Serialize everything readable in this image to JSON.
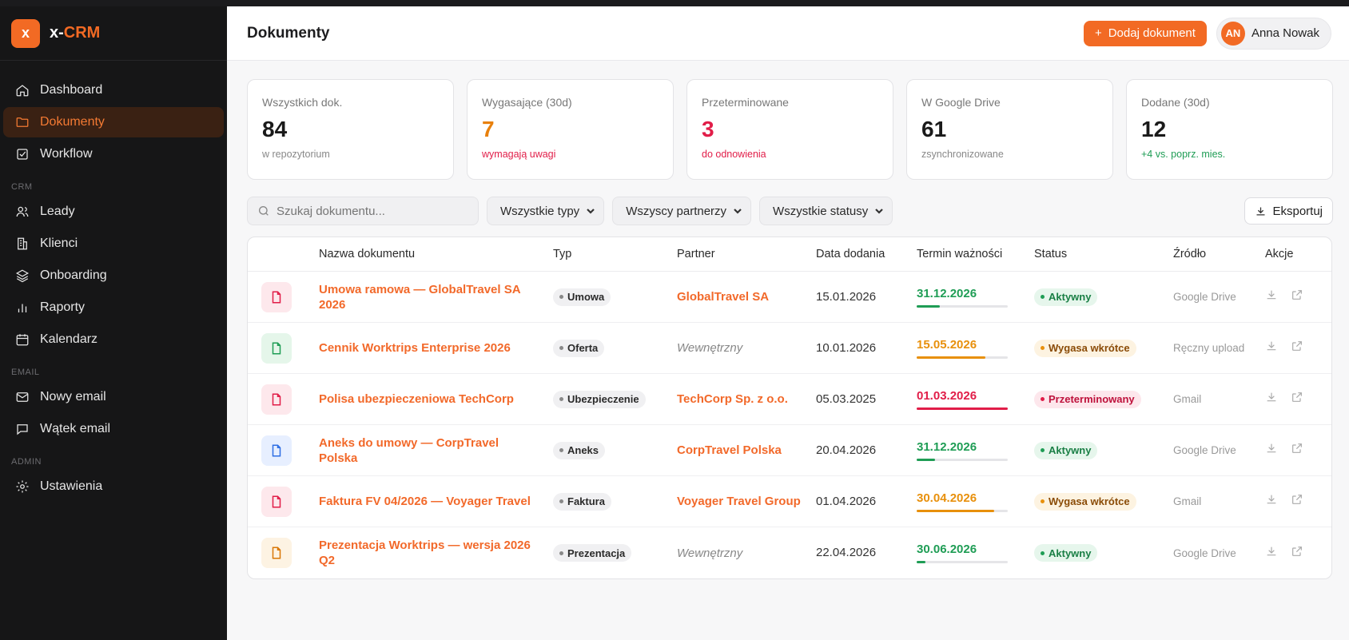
{
  "brand": {
    "logo_letter": "x",
    "name_prefix": "x-",
    "name_suffix": "CRM"
  },
  "colors": {
    "accent": "#f26a24",
    "sidebar_bg": "#161617",
    "active_bg": "#3a2113",
    "green": "#1f9d55",
    "orange": "#e8900c",
    "red": "#e11d48"
  },
  "sidebar": {
    "items": [
      {
        "label": "Dashboard",
        "icon": "home-icon",
        "active": false
      },
      {
        "label": "Dokumenty",
        "icon": "folder-icon",
        "active": true
      },
      {
        "label": "Workflow",
        "icon": "checkbox-icon",
        "active": false
      }
    ],
    "sections": [
      {
        "label": "CRM",
        "items": [
          {
            "label": "Leady",
            "icon": "users-icon"
          },
          {
            "label": "Klienci",
            "icon": "building-icon"
          },
          {
            "label": "Onboarding",
            "icon": "layers-icon"
          },
          {
            "label": "Raporty",
            "icon": "bar-chart-icon"
          },
          {
            "label": "Kalendarz",
            "icon": "calendar-icon"
          }
        ]
      },
      {
        "label": "EMAIL",
        "items": [
          {
            "label": "Nowy email",
            "icon": "mail-icon"
          },
          {
            "label": "Wątek email",
            "icon": "message-icon"
          }
        ]
      },
      {
        "label": "ADMIN",
        "items": [
          {
            "label": "Ustawienia",
            "icon": "gear-icon"
          }
        ]
      }
    ]
  },
  "header": {
    "title": "Dokumenty",
    "add_button": "Dodaj dokument",
    "user": {
      "initials": "AN",
      "name": "Anna Nowak"
    }
  },
  "stats": [
    {
      "label": "Wszystkich dok.",
      "value": "84",
      "sub": "w repozytorium",
      "value_color": "#1a1a1a",
      "sub_color": "#888888"
    },
    {
      "label": "Wygasające (30d)",
      "value": "7",
      "sub": "wymagają uwagi",
      "value_color": "#e8800c",
      "sub_color": "#e11d48"
    },
    {
      "label": "Przeterminowane",
      "value": "3",
      "sub": "do odnowienia",
      "value_color": "#e11d48",
      "sub_color": "#e11d48"
    },
    {
      "label": "W Google Drive",
      "value": "61",
      "sub": "zsynchronizowane",
      "value_color": "#1a1a1a",
      "sub_color": "#888888"
    },
    {
      "label": "Dodane (30d)",
      "value": "12",
      "sub": "+4 vs. poprz. mies.",
      "value_color": "#1a1a1a",
      "sub_color": "#1f9d55"
    }
  ],
  "filters": {
    "search_placeholder": "Szukaj dokumentu...",
    "type": "Wszystkie typy",
    "partner": "Wszyscy partnerzy",
    "status": "Wszystkie statusy",
    "export": "Eksportuj"
  },
  "table": {
    "columns": [
      "Nazwa dokumentu",
      "Typ",
      "Partner",
      "Data dodania",
      "Termin ważności",
      "Status",
      "Źródło",
      "Akcje"
    ],
    "rows": [
      {
        "name": "Umowa ramowa — GlobalTravel SA 2026",
        "type": "Umowa",
        "partner": "GlobalTravel SA",
        "partner_internal": false,
        "date": "15.01.2026",
        "expiry": "31.12.2026",
        "expiry_color": "#1f9d55",
        "progress": 0.25,
        "status": "Aktywny",
        "status_kind": "active",
        "source": "Google Drive",
        "icon_color": "#e11d48",
        "icon_bg": "#fde8ec"
      },
      {
        "name": "Cennik Worktrips Enterprise 2026",
        "type": "Oferta",
        "partner": "Wewnętrzny",
        "partner_internal": true,
        "date": "10.01.2026",
        "expiry": "15.05.2026",
        "expiry_color": "#e8900c",
        "progress": 0.75,
        "status": "Wygasa wkrótce",
        "status_kind": "warn",
        "source": "Ręczny upload",
        "icon_color": "#1f9d55",
        "icon_bg": "#e5f6ea"
      },
      {
        "name": "Polisa ubezpieczeniowa TechCorp",
        "type": "Ubezpieczenie",
        "partner": "TechCorp Sp. z o.o.",
        "partner_internal": false,
        "date": "05.03.2025",
        "expiry": "01.03.2026",
        "expiry_color": "#e11d48",
        "progress": 1.0,
        "status": "Przeterminowany",
        "status_kind": "expired",
        "source": "Gmail",
        "icon_color": "#e11d48",
        "icon_bg": "#fde8ec"
      },
      {
        "name": "Aneks do umowy — CorpTravel Polska",
        "type": "Aneks",
        "partner": "CorpTravel Polska",
        "partner_internal": false,
        "date": "20.04.2026",
        "expiry": "31.12.2026",
        "expiry_color": "#1f9d55",
        "progress": 0.2,
        "status": "Aktywny",
        "status_kind": "active",
        "source": "Google Drive",
        "icon_color": "#2f6fe4",
        "icon_bg": "#e7efff"
      },
      {
        "name": "Faktura FV 04/2026 — Voyager Travel",
        "type": "Faktura",
        "partner": "Voyager Travel Group",
        "partner_internal": false,
        "date": "01.04.2026",
        "expiry": "30.04.2026",
        "expiry_color": "#e8900c",
        "progress": 0.85,
        "status": "Wygasa wkrótce",
        "status_kind": "warn",
        "source": "Gmail",
        "icon_color": "#e11d48",
        "icon_bg": "#fde8ec"
      },
      {
        "name": "Prezentacja Worktrips — wersja 2026 Q2",
        "type": "Prezentacja",
        "partner": "Wewnętrzny",
        "partner_internal": true,
        "date": "22.04.2026",
        "expiry": "30.06.2026",
        "expiry_color": "#1f9d55",
        "progress": 0.1,
        "status": "Aktywny",
        "status_kind": "active",
        "source": "Google Drive",
        "icon_color": "#d97706",
        "icon_bg": "#fdf3e3"
      }
    ]
  }
}
